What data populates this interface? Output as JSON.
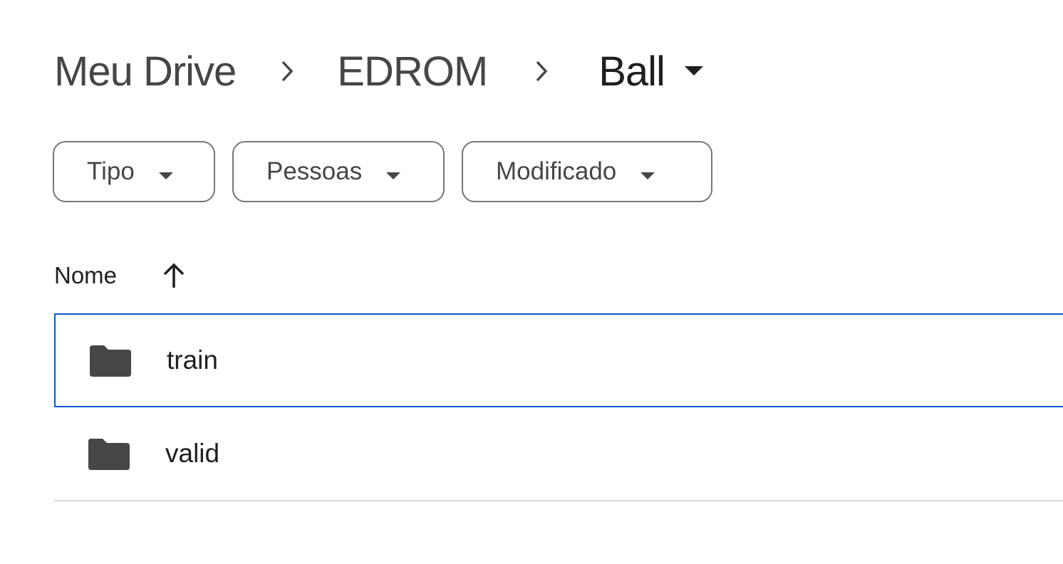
{
  "breadcrumb": {
    "items": [
      {
        "label": "Meu Drive"
      },
      {
        "label": "EDROM"
      },
      {
        "label": "Ball"
      }
    ],
    "separator_icon": "chevron-right-icon",
    "current_menu_icon": "caret-down-icon"
  },
  "filters": {
    "type_label": "Tipo",
    "people_label": "Pessoas",
    "modified_label": "Modificado"
  },
  "list": {
    "column_name": "Nome",
    "sort_direction": "ascending",
    "rows": [
      {
        "name": "train",
        "icon": "folder-icon",
        "selected": true
      },
      {
        "name": "valid",
        "icon": "folder-icon",
        "selected": false
      }
    ]
  },
  "colors": {
    "selection_border": "#0b57d0",
    "icon": "#444746",
    "divider": "#dadce0"
  }
}
